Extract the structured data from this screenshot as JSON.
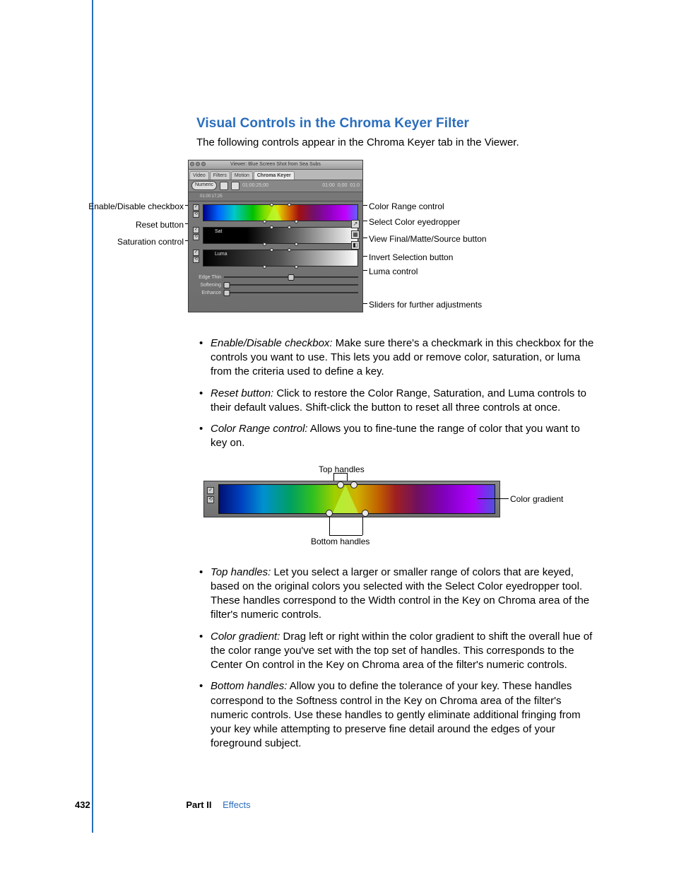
{
  "heading": "Visual Controls in the Chroma Keyer Filter",
  "intro": "The following controls appear in the Chroma Keyer tab in the Viewer.",
  "fig1": {
    "windowTitle": "Viewer: Blue Screen Shot from Sea Subs",
    "tabs": {
      "video": "Video",
      "filters": "Filters",
      "motion": "Motion",
      "chroma": "Chroma Keyer"
    },
    "numericBtn": "Numeric",
    "tc1": "01:00:25;00",
    "tc2": "01:00",
    "tc3": "0;00",
    "tc4": "01:0",
    "rulerTc": "01:00:17;25",
    "rowLabels": {
      "sat": "Sat",
      "luma": "Luma"
    },
    "sliders": {
      "edgeThin": "Edge Thin",
      "softening": "Softening",
      "enhance": "Enhance"
    },
    "rightButtons": {
      "eyedrop": "↗",
      "matte": "▦",
      "invert": "◧"
    },
    "checkmark": "✓",
    "resetGlyph": "⟲",
    "callouts": {
      "enable": "Enable/Disable checkbox",
      "reset": "Reset button",
      "satCtrl": "Saturation control",
      "colorRange": "Color Range control",
      "eyedropper": "Select Color eyedropper",
      "viewBtn": "View Final/Matte/Source button",
      "invert": "Invert Selection button",
      "luma": "Luma control",
      "sliders": "Sliders for further adjustments"
    }
  },
  "defs1": {
    "enable": {
      "term": "Enable/Disable checkbox:",
      "text": "  Make sure there's a checkmark in this checkbox for the controls you want to use. This lets you add or remove color, saturation, or luma from the criteria used to define a key."
    },
    "reset": {
      "term": "Reset button:",
      "text": "  Click to restore the Color Range, Saturation, and Luma controls to their default values. Shift-click the button to reset all three controls at once."
    },
    "colorRange": {
      "term": "Color Range control:",
      "text": "  Allows you to fine-tune the range of color that you want to key on."
    }
  },
  "fig2": {
    "topHandles": "Top handles",
    "bottomHandles": "Bottom handles",
    "colorGradient": "Color gradient",
    "checkmark": "✓",
    "resetGlyph": "⟲"
  },
  "defs2": {
    "top": {
      "term": "Top handles:",
      "text": "  Let you select a larger or smaller range of colors that are keyed, based on the original colors you selected with the Select Color eyedropper tool. These handles correspond to the Width control in the Key on Chroma area of the filter's numeric controls."
    },
    "grad": {
      "term": "Color gradient:",
      "text": "  Drag left or right within the color gradient to shift the overall hue of the color range you've set with the top set of handles. This corresponds to the Center On control in the Key on Chroma area of the filter's numeric controls."
    },
    "bot": {
      "term": "Bottom handles:",
      "text": "  Allow you to define the tolerance of your key. These handles correspond to the Softness control in the Key on Chroma area of the filter's numeric controls. Use these handles to gently eliminate additional fringing from your key while attempting to preserve fine detail around the edges of your foreground subject."
    }
  },
  "footer": {
    "page": "432",
    "part": "Part II",
    "section": "Effects"
  }
}
